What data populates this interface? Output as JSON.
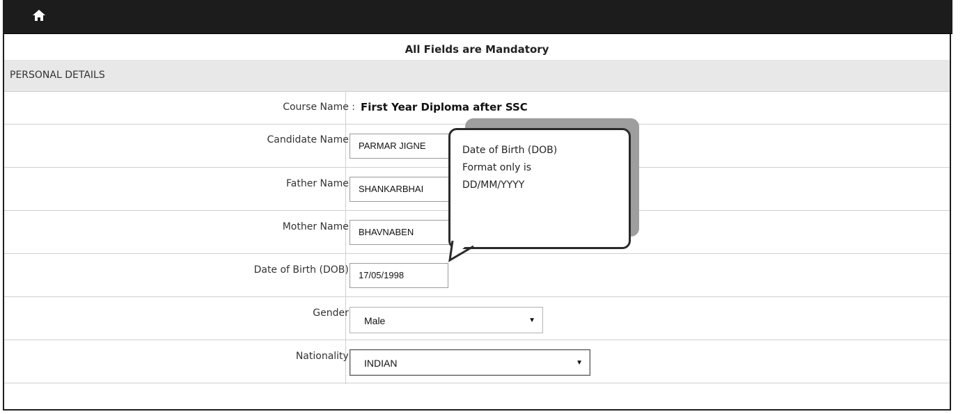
{
  "header": {
    "home_icon": "home-icon"
  },
  "notice": "All Fields are Mandatory",
  "section": {
    "title": "PERSONAL DETAILS"
  },
  "form": {
    "course_label": "Course Name :",
    "course_value": "First Year Diploma after SSC",
    "candidate_label": "Candidate Name :",
    "candidate_value": "PARMAR JIGNE",
    "father_label": "Father Name :",
    "father_value": "SHANKARBHAI",
    "mother_label": "Mother Name :",
    "mother_value": "BHAVNABEN",
    "dob_label": "Date of Birth (DOB) :",
    "dob_value": "17/05/1998",
    "gender_label": "Gender :",
    "gender_value": "Male",
    "nationality_label": "Nationality :",
    "nationality_value": "INDIAN"
  },
  "tooltip": {
    "line1": "Date of Birth (DOB)",
    "line2": "Format only is",
    "line3": "DD/MM/YYYY"
  },
  "colors": {
    "topbar": "#1c1c1c",
    "section_bg": "#e8e8e8",
    "border": "#cfcfcf"
  }
}
